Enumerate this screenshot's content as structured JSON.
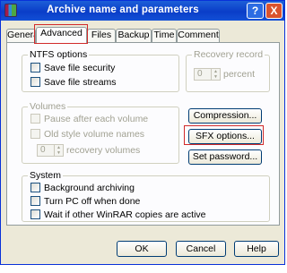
{
  "window": {
    "title": "Archive name and parameters",
    "help_glyph": "?",
    "close_glyph": "X"
  },
  "tabs": [
    {
      "label": "General"
    },
    {
      "label": "Advanced",
      "selected": true
    },
    {
      "label": "Files"
    },
    {
      "label": "Backup"
    },
    {
      "label": "Time"
    },
    {
      "label": "Comment"
    }
  ],
  "ntfs": {
    "legend": "NTFS options",
    "options": [
      "Save file security",
      "Save file streams"
    ]
  },
  "recovery": {
    "legend": "Recovery record",
    "value": "0",
    "unit": "percent"
  },
  "volumes": {
    "legend": "Volumes",
    "options": [
      "Pause after each volume",
      "Old style volume names"
    ],
    "spinner_value": "0",
    "spinner_unit": "recovery volumes"
  },
  "buttons": {
    "compression": "Compression...",
    "sfx": "SFX options...",
    "password": "Set password..."
  },
  "system": {
    "legend": "System",
    "options": [
      "Background archiving",
      "Turn PC off when done",
      "Wait if other WinRAR copies are active"
    ]
  },
  "footer": {
    "ok": "OK",
    "cancel": "Cancel",
    "help": "Help"
  },
  "colors": {
    "titlebar": "#0a3dc8",
    "highlight": "#d12a2a",
    "panel": "#fcfcfe",
    "face": "#ece9d8"
  }
}
